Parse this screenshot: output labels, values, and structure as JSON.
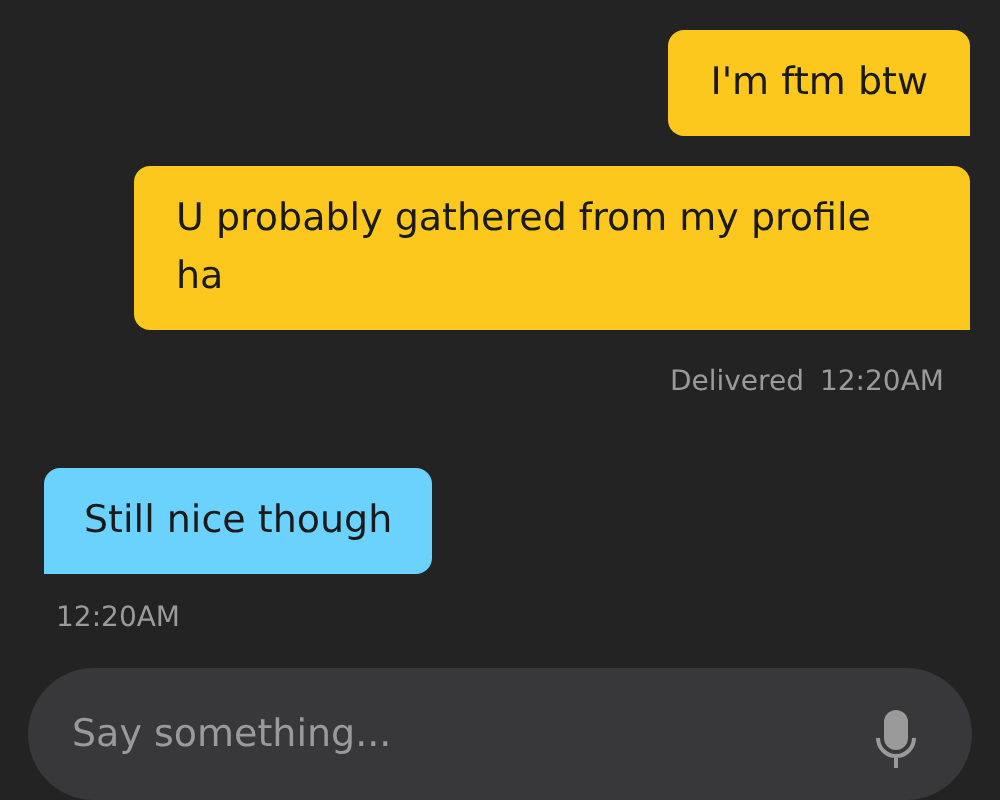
{
  "messages": [
    {
      "kind": "sent",
      "text": "I'm ftm btw"
    },
    {
      "kind": "sent",
      "text": "U probably gathered from my profile ha"
    },
    {
      "kind": "meta",
      "status": "Delivered",
      "time": "12:20AM"
    },
    {
      "kind": "received",
      "text": "Still nice though"
    },
    {
      "kind": "meta",
      "time": "12:20AM"
    }
  ],
  "composer": {
    "placeholder": "Say something..."
  }
}
